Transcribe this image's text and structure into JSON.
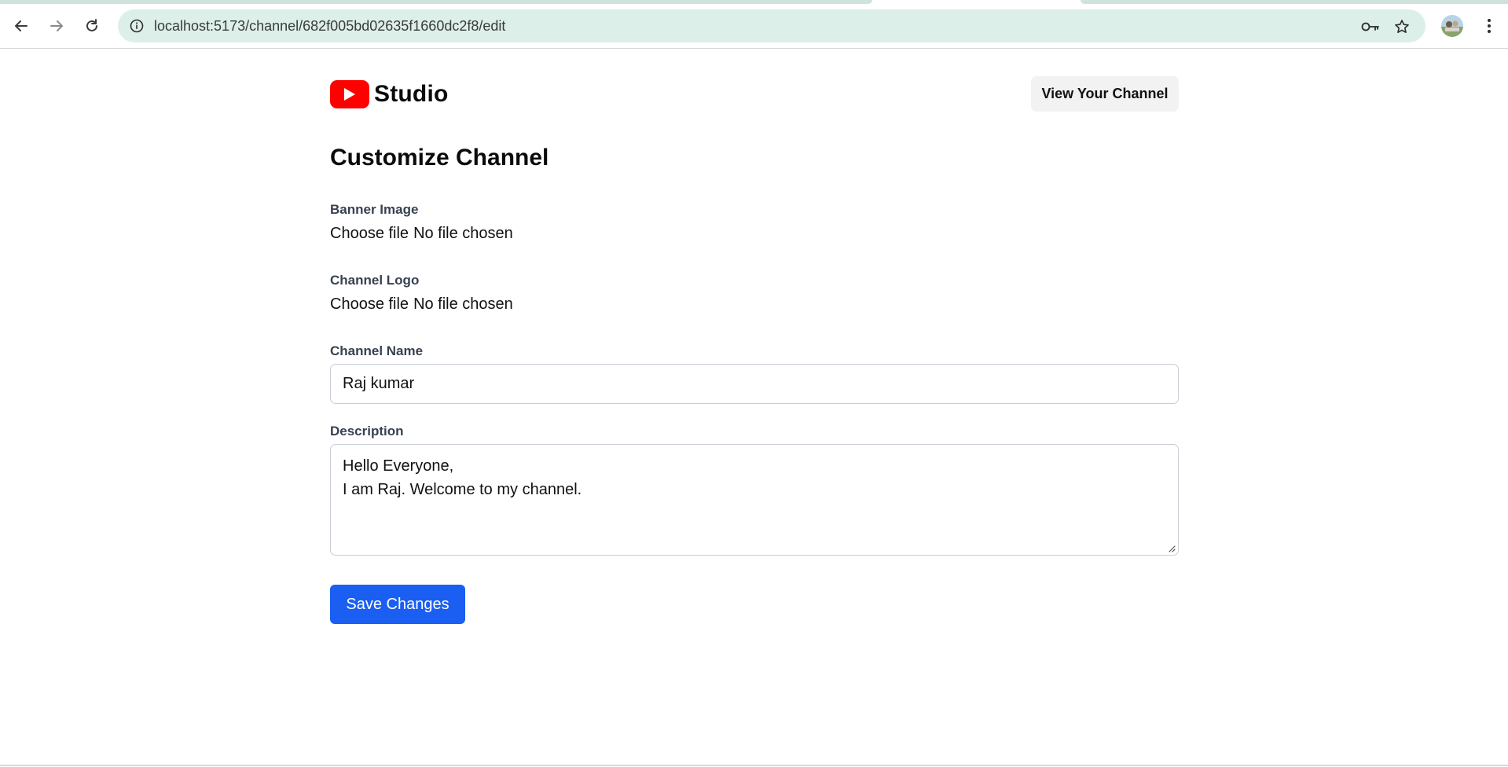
{
  "browser": {
    "url": "localhost:5173/channel/682f005bd02635f1660dc2f8/edit",
    "icons": {
      "back": "arrow-left-icon",
      "forward": "arrow-right-icon",
      "reload": "reload-icon",
      "site_info": "info-icon",
      "password": "key-icon",
      "bookmark": "star-icon",
      "menu": "more-vert-icon"
    },
    "omnibox_color": "#dcefe9"
  },
  "header": {
    "brand_text": "Studio",
    "logo_color": "#ff0000",
    "view_channel_label": "View Your Channel"
  },
  "page": {
    "title": "Customize Channel"
  },
  "form": {
    "banner": {
      "label": "Banner Image",
      "button_text": "Choose file",
      "status_text": "No file chosen"
    },
    "logo": {
      "label": "Channel Logo",
      "button_text": "Choose file",
      "status_text": "No file chosen"
    },
    "channel_name": {
      "label": "Channel Name",
      "value": "Raj kumar"
    },
    "description": {
      "label": "Description",
      "lines": [
        "Hello Everyone,",
        "I am Raj. Welcome to my channel."
      ]
    },
    "save_label": "Save Changes",
    "save_color": "#1a5ff2"
  }
}
